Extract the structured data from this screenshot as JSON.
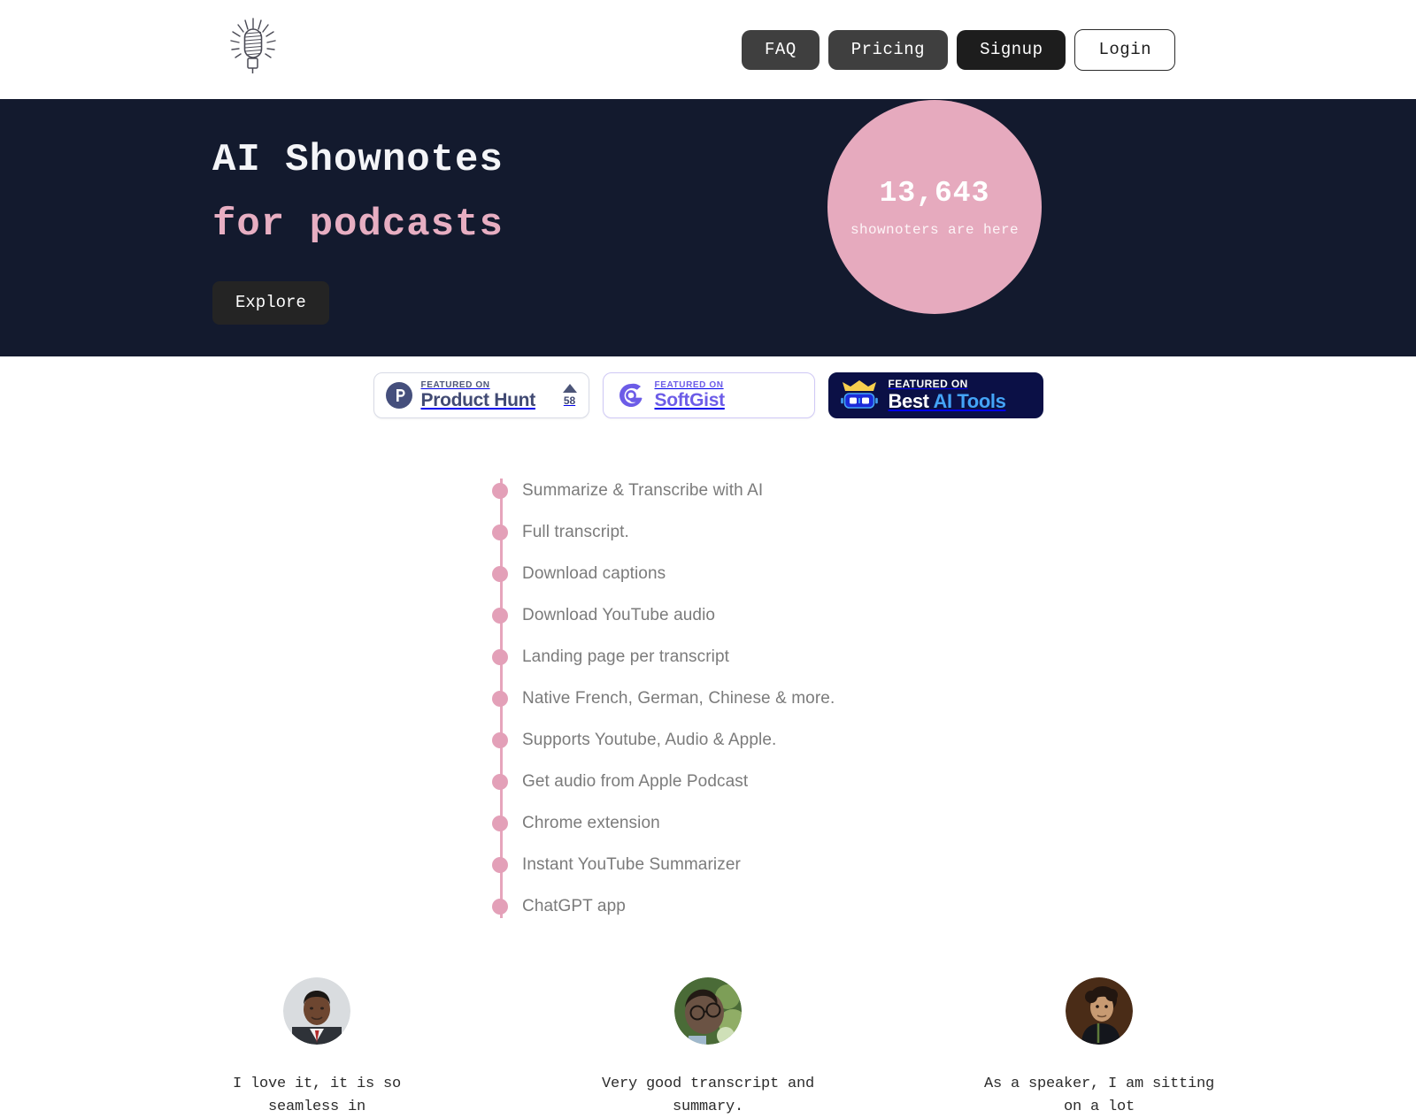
{
  "header": {
    "logo_icon": "microphone-logo",
    "nav": [
      {
        "label": "FAQ",
        "style": "grey"
      },
      {
        "label": "Pricing",
        "style": "grey"
      },
      {
        "label": "Signup",
        "style": "dark"
      },
      {
        "label": "Login",
        "style": "outline"
      }
    ]
  },
  "hero": {
    "title": "AI Shownotes",
    "subtitle": "for podcasts",
    "cta_label": "Explore",
    "badge": {
      "count": "13,643",
      "label": "shownoters are here"
    },
    "bg_color": "#131a2e",
    "accent_color": "#e7aec2"
  },
  "featured_badges": [
    {
      "id": "product-hunt",
      "kicker": "FEATURED ON",
      "name": "Product Hunt",
      "upvotes": "58",
      "color": "#414a73",
      "icon": "product-hunt-icon"
    },
    {
      "id": "softgist",
      "kicker": "FEATURED ON",
      "name": "SoftGist",
      "color": "#6c5ce7",
      "icon": "softgist-icon"
    },
    {
      "id": "best-ai-tools",
      "kicker": "FEATURED ON",
      "name_part1": "Best ",
      "name_part2": "AI Tools",
      "color": "#44a4f7",
      "bg_color": "#0b1046",
      "icon": "crown-robot-icon"
    }
  ],
  "features": [
    {
      "label": "Summarize & Transcribe with AI"
    },
    {
      "label": "Full transcript."
    },
    {
      "label": "Download captions"
    },
    {
      "label": "Download YouTube audio"
    },
    {
      "label": "Landing page per transcript"
    },
    {
      "label": "Native French, German, Chinese & more."
    },
    {
      "label": "Supports Youtube, Audio & Apple."
    },
    {
      "label": "Get audio from Apple Podcast"
    },
    {
      "label": "Chrome extension"
    },
    {
      "label": "Instant YouTube Summarizer"
    },
    {
      "label": "ChatGPT app"
    }
  ],
  "features_dot_color": "#e3a0b8",
  "testimonials": [
    {
      "avatar": "avatar-man-in-suit",
      "quote": "I love it, it is so seamless in"
    },
    {
      "avatar": "avatar-person-with-glasses",
      "quote": "Very good transcript and summary."
    },
    {
      "avatar": "avatar-curly-haired-man",
      "quote": "As a speaker, I am sitting on a lot"
    }
  ]
}
